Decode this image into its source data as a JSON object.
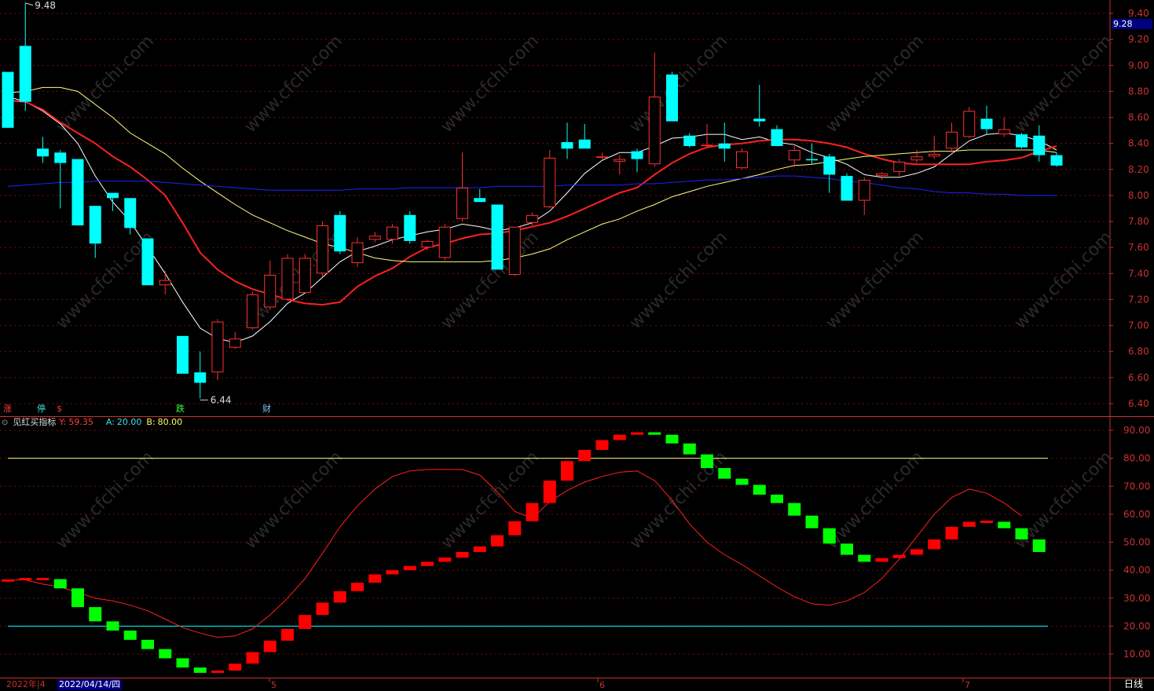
{
  "indicator": {
    "name": "见红买指标",
    "y_label": "Y:",
    "y_value": "59.35",
    "a_label": "A:",
    "a_value": "20.00",
    "b_label": "B:",
    "b_value": "80.00",
    "dropdown_icon": "chevron-down-circle-icon"
  },
  "price_axis_ticks": [
    "9.40",
    "9.20",
    "9.00",
    "8.80",
    "8.60",
    "8.40",
    "8.20",
    "8.00",
    "7.80",
    "7.60",
    "7.40",
    "7.20",
    "7.00",
    "6.80",
    "6.60",
    "6.40"
  ],
  "indicator_axis_ticks": [
    "90.00",
    "80.00",
    "70.00",
    "60.00",
    "50.00",
    "40.00",
    "30.00",
    "20.00",
    "10.00"
  ],
  "current_price_tag": "9.28",
  "high_label": "9.48",
  "low_label": "6.44",
  "markers": [
    {
      "text": "涨",
      "color": "#ff4040"
    },
    {
      "text": "停",
      "color": "#40e0e0"
    },
    {
      "text": "$",
      "color": "#ff3030"
    },
    {
      "text": "跌",
      "color": "#40ff40"
    },
    {
      "text": "财",
      "color": "#80c0ff"
    }
  ],
  "date_axis": {
    "left_label": "2022年|4",
    "cursor_date": "2022/04/14/四",
    "month_5": "5",
    "month_6": "6",
    "month_7": "7",
    "period": "日线"
  },
  "watermark": "www.cfchi.com",
  "colors": {
    "up": "#ff3030",
    "down": "#00ffff",
    "ma5": "#ffffff",
    "ma10": "#ff2020",
    "ma20": "#ffff80",
    "ma60": "#2020ff",
    "ind_up": "#ff0000",
    "ind_down": "#00ff00",
    "line_a": "#00ffff",
    "line_b": "#ffff80"
  },
  "chart_data": [
    {
      "type": "candlestick",
      "ylim": [
        6.35,
        9.5
      ],
      "candles": [
        [
          8.95,
          8.52,
          8.95,
          8.52
        ],
        [
          9.15,
          8.72,
          9.48,
          8.65
        ],
        [
          8.36,
          8.3,
          8.45,
          8.25
        ],
        [
          8.33,
          8.25,
          8.35,
          7.9
        ],
        [
          8.28,
          7.77,
          8.28,
          7.77
        ],
        [
          7.92,
          7.63,
          7.92,
          7.52
        ],
        [
          8.02,
          7.98,
          8.02,
          7.88
        ],
        [
          7.98,
          7.75,
          7.98,
          7.7
        ],
        [
          7.67,
          7.31,
          7.67,
          7.31
        ],
        [
          7.31,
          7.35,
          7.42,
          7.24
        ],
        [
          6.92,
          6.63,
          6.92,
          6.63
        ],
        [
          6.64,
          6.56,
          6.8,
          6.44
        ],
        [
          6.64,
          7.03,
          7.05,
          6.58
        ],
        [
          6.83,
          6.9,
          6.95,
          6.82
        ],
        [
          6.98,
          7.24,
          7.26,
          6.97
        ],
        [
          7.14,
          7.39,
          7.5,
          7.12
        ],
        [
          7.2,
          7.52,
          7.55,
          7.2
        ],
        [
          7.25,
          7.52,
          7.55,
          7.25
        ],
        [
          7.4,
          7.77,
          7.8,
          7.38
        ],
        [
          7.85,
          7.57,
          7.88,
          7.55
        ],
        [
          7.48,
          7.64,
          7.68,
          7.45
        ],
        [
          7.66,
          7.69,
          7.72,
          7.64
        ],
        [
          7.66,
          7.76,
          7.78,
          7.63
        ],
        [
          7.85,
          7.65,
          7.88,
          7.63
        ],
        [
          7.6,
          7.65,
          7.66,
          7.58
        ],
        [
          7.52,
          7.76,
          7.78,
          7.5
        ],
        [
          7.82,
          8.06,
          8.33,
          7.8
        ],
        [
          7.98,
          7.95,
          8.05,
          7.95
        ],
        [
          7.93,
          7.43,
          7.93,
          7.43
        ],
        [
          7.39,
          7.76,
          7.76,
          7.38
        ],
        [
          7.79,
          7.85,
          7.87,
          7.77
        ],
        [
          7.91,
          8.29,
          8.35,
          7.9
        ],
        [
          8.41,
          8.36,
          8.56,
          8.28
        ],
        [
          8.43,
          8.36,
          8.55,
          8.36
        ],
        [
          8.29,
          8.3,
          8.33,
          8.28
        ],
        [
          8.26,
          8.28,
          8.31,
          8.16
        ],
        [
          8.34,
          8.28,
          8.36,
          8.18
        ],
        [
          8.24,
          8.76,
          9.1,
          8.22
        ],
        [
          8.93,
          8.57,
          8.95,
          8.57
        ],
        [
          8.46,
          8.38,
          8.48,
          8.37
        ],
        [
          8.38,
          8.39,
          8.55,
          8.37
        ],
        [
          8.4,
          8.36,
          8.56,
          8.26
        ],
        [
          8.21,
          8.34,
          8.36,
          8.2
        ],
        [
          8.59,
          8.57,
          8.85,
          8.53
        ],
        [
          8.51,
          8.38,
          8.54,
          8.38
        ],
        [
          8.27,
          8.35,
          8.38,
          8.22
        ],
        [
          8.28,
          8.27,
          8.4,
          8.24
        ],
        [
          8.3,
          8.16,
          8.32,
          8.02
        ],
        [
          8.15,
          7.96,
          8.17,
          7.96
        ],
        [
          7.96,
          8.12,
          8.14,
          7.85
        ],
        [
          8.15,
          8.17,
          8.18,
          8.12
        ],
        [
          8.18,
          8.26,
          8.28,
          8.15
        ],
        [
          8.27,
          8.3,
          8.35,
          8.25
        ],
        [
          8.3,
          8.32,
          8.46,
          8.28
        ],
        [
          8.36,
          8.49,
          8.56,
          8.33
        ],
        [
          8.45,
          8.65,
          8.68,
          8.44
        ],
        [
          8.59,
          8.51,
          8.69,
          8.47
        ],
        [
          8.47,
          8.51,
          8.6,
          8.45
        ],
        [
          8.47,
          8.37,
          8.48,
          8.36
        ],
        [
          8.46,
          8.31,
          8.54,
          8.26
        ],
        [
          8.31,
          8.23,
          8.33,
          8.22
        ]
      ],
      "series": [
        {
          "name": "MA5",
          "values": [
            8.76,
            8.72,
            8.65,
            8.55,
            8.4,
            8.15,
            7.95,
            7.8,
            7.6,
            7.4,
            7.18,
            6.98,
            6.9,
            6.87,
            6.92,
            7.03,
            7.17,
            7.25,
            7.37,
            7.49,
            7.57,
            7.61,
            7.66,
            7.69,
            7.72,
            7.74,
            7.78,
            7.76,
            7.73,
            7.75,
            7.79,
            7.88,
            8.02,
            8.17,
            8.27,
            8.33,
            8.33,
            8.38,
            8.44,
            8.45,
            8.47,
            8.47,
            8.43,
            8.45,
            8.41,
            8.39,
            8.33,
            8.29,
            8.24,
            8.16,
            8.14,
            8.14,
            8.17,
            8.22,
            8.32,
            8.42,
            8.47,
            8.48,
            8.46,
            8.42,
            8.35
          ]
        },
        {
          "name": "MA10",
          "values": [
            8.73,
            8.72,
            8.66,
            8.56,
            8.48,
            8.4,
            8.3,
            8.22,
            8.12,
            8.0,
            7.79,
            7.56,
            7.43,
            7.34,
            7.28,
            7.24,
            7.2,
            7.17,
            7.16,
            7.18,
            7.3,
            7.38,
            7.44,
            7.53,
            7.6,
            7.63,
            7.67,
            7.7,
            7.71,
            7.73,
            7.76,
            7.79,
            7.84,
            7.9,
            7.96,
            8.02,
            8.06,
            8.16,
            8.25,
            8.32,
            8.37,
            8.39,
            8.4,
            8.42,
            8.43,
            8.43,
            8.42,
            8.4,
            8.37,
            8.32,
            8.28,
            8.25,
            8.24,
            8.24,
            8.24,
            8.24,
            8.26,
            8.27,
            8.29,
            8.34,
            8.38
          ]
        },
        {
          "name": "MA20",
          "values": [
            8.79,
            8.8,
            8.83,
            8.83,
            8.8,
            8.7,
            8.6,
            8.48,
            8.4,
            8.32,
            8.21,
            8.11,
            8.02,
            7.93,
            7.85,
            7.79,
            7.73,
            7.68,
            7.63,
            7.6,
            7.56,
            7.52,
            7.5,
            7.49,
            7.49,
            7.49,
            7.49,
            7.49,
            7.5,
            7.52,
            7.55,
            7.59,
            7.66,
            7.72,
            7.78,
            7.82,
            7.88,
            7.93,
            7.99,
            8.03,
            8.07,
            8.1,
            8.13,
            8.16,
            8.2,
            8.23,
            8.24,
            8.26,
            8.28,
            8.3,
            8.31,
            8.32,
            8.33,
            8.34,
            8.34,
            8.35,
            8.35,
            8.35,
            8.35,
            8.35,
            8.33
          ]
        },
        {
          "name": "MA60",
          "values": [
            8.07,
            8.08,
            8.09,
            8.1,
            8.1,
            8.11,
            8.11,
            8.11,
            8.11,
            8.1,
            8.09,
            8.08,
            8.07,
            8.06,
            8.05,
            8.04,
            8.04,
            8.04,
            8.04,
            8.04,
            8.05,
            8.05,
            8.05,
            8.06,
            8.06,
            8.06,
            8.06,
            8.06,
            8.07,
            8.07,
            8.07,
            8.07,
            8.08,
            8.08,
            8.08,
            8.08,
            8.09,
            8.09,
            8.1,
            8.11,
            8.12,
            8.12,
            8.13,
            8.14,
            8.15,
            8.15,
            8.14,
            8.13,
            8.11,
            8.1,
            8.08,
            8.06,
            8.05,
            8.03,
            8.02,
            8.02,
            8.01,
            8.01,
            8.0,
            8.0,
            8.0
          ]
        }
      ]
    },
    {
      "type": "bar",
      "ylim": [
        0,
        95
      ],
      "reference_lines": {
        "A": 20,
        "B": 80
      },
      "blocks": [
        [
          36.3,
          36.3
        ],
        [
          36.8,
          36.8
        ],
        [
          36.8,
          36.8
        ],
        [
          36.8,
          33.5
        ],
        [
          33.5,
          26.8
        ],
        [
          26.8,
          21.7
        ],
        [
          21.7,
          18.4
        ],
        [
          18.4,
          15.1
        ],
        [
          15.1,
          11.8
        ],
        [
          11.8,
          8.5
        ],
        [
          8.5,
          5.2
        ],
        [
          5.2,
          3.3
        ],
        [
          3.3,
          4.1
        ],
        [
          4.1,
          6.6
        ],
        [
          6.6,
          10.7
        ],
        [
          10.7,
          14.8
        ],
        [
          14.8,
          19.0
        ],
        [
          19.0,
          24.0
        ],
        [
          24.0,
          28.4
        ],
        [
          28.4,
          32.5
        ],
        [
          32.5,
          35.5
        ],
        [
          35.5,
          38.5
        ],
        [
          38.5,
          40.0
        ],
        [
          40.0,
          41.5
        ],
        [
          41.5,
          43.0
        ],
        [
          43.0,
          44.5
        ],
        [
          44.5,
          46.5
        ],
        [
          46.5,
          48.5
        ],
        [
          48.5,
          52.5
        ],
        [
          52.5,
          57.5
        ],
        [
          57.5,
          64.0
        ],
        [
          64.0,
          72.0
        ],
        [
          72.0,
          79.0
        ],
        [
          79.0,
          83.0
        ],
        [
          83.0,
          86.5
        ],
        [
          86.5,
          88.4
        ],
        [
          88.4,
          89.3
        ],
        [
          89.3,
          88.4
        ],
        [
          88.4,
          85.3
        ],
        [
          85.3,
          81.4
        ],
        [
          81.4,
          76.5
        ],
        [
          76.5,
          72.7
        ],
        [
          72.7,
          70.5
        ],
        [
          70.5,
          67.0
        ],
        [
          67.0,
          64.0
        ],
        [
          64.0,
          59.5
        ],
        [
          59.5,
          55.0
        ],
        [
          55.0,
          49.5
        ],
        [
          49.5,
          45.5
        ],
        [
          45.5,
          43.0
        ],
        [
          43.0,
          44.3
        ],
        [
          44.3,
          45.5
        ],
        [
          45.5,
          47.5
        ],
        [
          47.5,
          51.0
        ],
        [
          51.0,
          55.5
        ],
        [
          55.5,
          57.3
        ],
        [
          57.3,
          57.3
        ],
        [
          57.3,
          55.0
        ],
        [
          55.0,
          51.0
        ],
        [
          51.0,
          46.5
        ]
      ],
      "series": [
        {
          "name": "Y",
          "values": [
            36.5,
            36.5,
            35.0,
            34.0,
            32.0,
            30.0,
            29.0,
            27.5,
            25.5,
            22.5,
            19.5,
            17.5,
            16.0,
            16.5,
            19.0,
            24.0,
            30.0,
            37.0,
            46.0,
            55.5,
            63.0,
            69.0,
            73.5,
            75.5,
            76.0,
            76.0,
            76.0,
            74.0,
            68.0,
            61.0,
            58.5,
            64.5,
            68.5,
            71.5,
            73.5,
            75.0,
            75.5,
            72.0,
            65.0,
            56.5,
            50.0,
            45.5,
            42.0,
            38.0,
            34.0,
            30.5,
            28.0,
            27.5,
            29.0,
            32.0,
            37.0,
            44.0,
            52.0,
            60.0,
            66.0,
            69.0,
            67.5,
            64.0,
            59.35
          ]
        }
      ]
    }
  ]
}
